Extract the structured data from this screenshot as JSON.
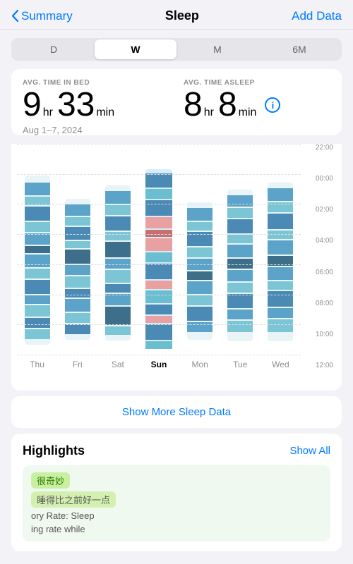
{
  "header": {
    "back_label": "Summary",
    "title": "Sleep",
    "action_label": "Add Data"
  },
  "segment": {
    "items": [
      "D",
      "W",
      "M",
      "6M"
    ],
    "active_index": 1
  },
  "stats": {
    "avg_time_in_bed_label": "AVG. TIME IN BED",
    "avg_time_asleep_label": "AVG. TIME ASLEEP",
    "bed_hours": "9",
    "bed_hr_unit": "hr",
    "bed_minutes": "33",
    "bed_min_unit": "min",
    "sleep_hours": "8",
    "sleep_hr_unit": "hr",
    "sleep_minutes": "8",
    "sleep_min_unit": "min",
    "date_range": "Aug 1–7, 2024"
  },
  "chart": {
    "y_labels": [
      "22:00",
      "00:00",
      "02:00",
      "04:00",
      "06:00",
      "08:00",
      "10:00",
      "12:00"
    ],
    "days": [
      "Thu",
      "Fri",
      "Sat",
      "Sun",
      "Mon",
      "Tue",
      "Wed"
    ],
    "active_day": "Sun"
  },
  "show_more": {
    "label": "Show More Sleep Data"
  },
  "highlights": {
    "title": "Highlights",
    "show_all_label": "Show All",
    "card": {
      "tag": "很奇妙",
      "subtitle": "睡得比之前好一点",
      "text_partial": "ory Rate: Sleep",
      "text2_partial": "ing rate while"
    }
  }
}
